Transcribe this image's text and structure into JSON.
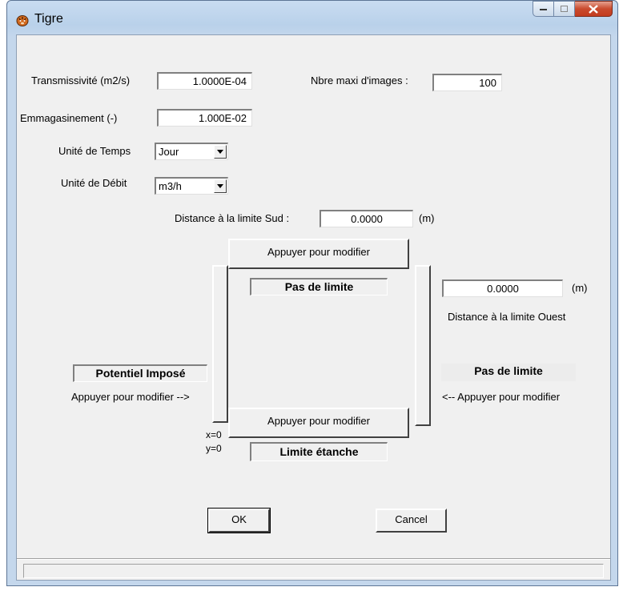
{
  "window": {
    "title": "Tigre",
    "icon": "tiger-head-icon"
  },
  "fields": {
    "transmissivite": {
      "label": "Transmissivité (m2/s)",
      "value": "1.0000E-04"
    },
    "nbre_images": {
      "label": "Nbre maxi d'images :",
      "value": "100"
    },
    "emmagasinement": {
      "label": "Emmagasinement (-)",
      "value": "1.000E-02"
    },
    "unite_temps": {
      "label": "Unité de Temps",
      "value": "Jour"
    },
    "unite_debit": {
      "label": "Unité de Débit",
      "value": "m3/h"
    },
    "distance_sud": {
      "label": "Distance à la limite Sud :",
      "value": "0.0000",
      "unit": "(m)"
    },
    "distance_ouest": {
      "label": "Distance à la limite Ouest",
      "value": "0.0000",
      "unit": "(m)"
    }
  },
  "boundaries": {
    "north": {
      "button": "Appuyer pour modifier",
      "status": "Pas de limite"
    },
    "south": {
      "button": "Appuyer pour modifier",
      "status": "Limite étanche"
    },
    "west": {
      "hint": "Appuyer pour modifier -->",
      "status": "Potentiel Imposé"
    },
    "east": {
      "hint": "<-- Appuyer pour modifier",
      "status": "Pas de limite"
    }
  },
  "origin": {
    "x": "x=0",
    "y": "y=0"
  },
  "actions": {
    "ok": "OK",
    "cancel": "Cancel"
  },
  "status_bar": {
    "text": ""
  }
}
